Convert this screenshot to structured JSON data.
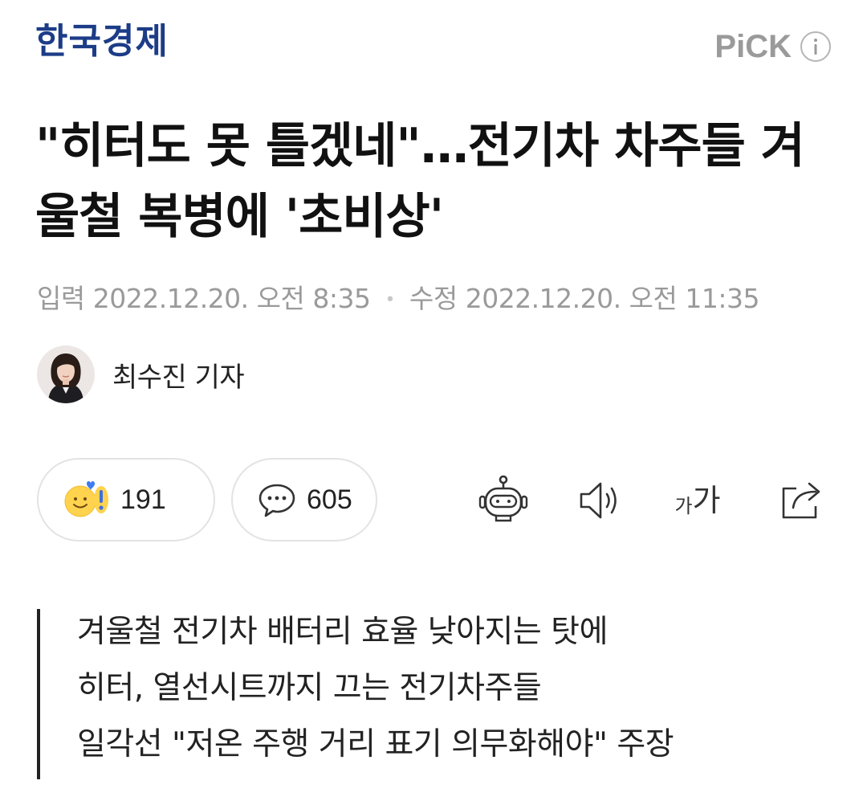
{
  "header": {
    "press_name": "한국경제",
    "pick_label": "PiCK",
    "info_icon": "info-icon",
    "colors": {
      "press": "#1c3c87",
      "pick": "#9a9a9a"
    }
  },
  "article": {
    "title": "\"히터도 못 틀겠네\"…전기차 차주들 겨울철 복병에 '초비상'",
    "published_label": "입력",
    "published": "2022.12.20. 오전 8:35",
    "modified_label": "수정",
    "modified": "2022.12.20. 오전 11:35",
    "separator": "•"
  },
  "author": {
    "name": "최수진 기자"
  },
  "actions": {
    "reaction_count": "191",
    "comment_count": "605",
    "icons": {
      "reaction": "reaction-emoji-icon",
      "comment": "comment-bubble-icon",
      "bot": "summary-bot-icon",
      "tts": "speaker-icon",
      "font_size": "font-size-icon",
      "share": "share-icon"
    },
    "font_small": "가",
    "font_big": "가"
  },
  "summary": {
    "lines": [
      "겨울철 전기차 배터리 효율 낮아지는 탓에",
      "히터, 열선시트까지 끄는 전기차주들",
      "일각선 \"저온 주행 거리 표기 의무화해야\" 주장"
    ]
  }
}
